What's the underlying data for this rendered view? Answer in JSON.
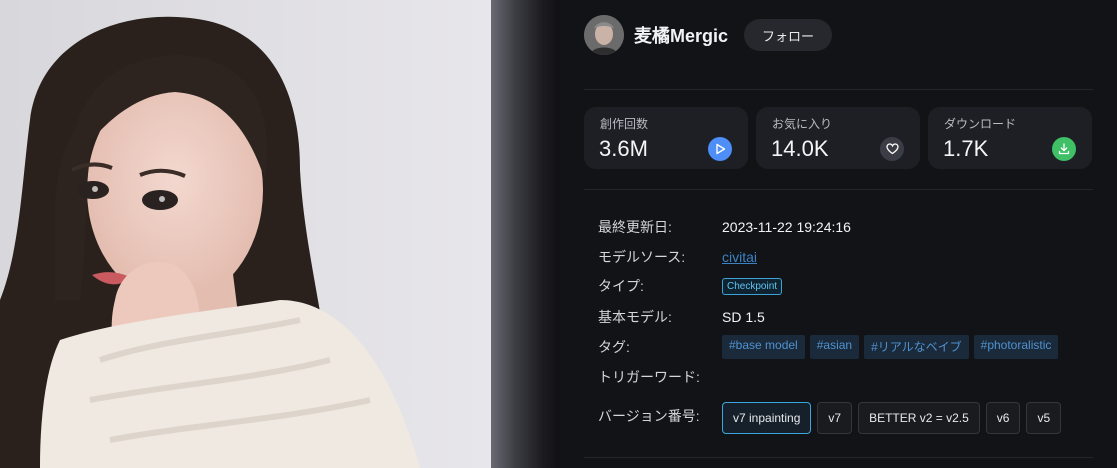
{
  "author": {
    "name": "麦橘Mergic",
    "follow_label": "フォロー"
  },
  "stats": [
    {
      "label": "創作回数",
      "value": "3.6M",
      "icon": "play-icon",
      "color": "#4d8ef7"
    },
    {
      "label": "お気に入り",
      "value": "14.0K",
      "icon": "heart-icon",
      "color": "#3a3d45"
    },
    {
      "label": "ダウンロード",
      "value": "1.7K",
      "icon": "download-icon",
      "color": "#3fbf66"
    }
  ],
  "meta": {
    "updated_label": "最終更新日:",
    "updated_value": "2023-11-22 19:24:16",
    "source_label": "モデルソース:",
    "source_value": "civitai",
    "type_label": "タイプ:",
    "type_value": "Checkpoint",
    "base_label": "基本モデル:",
    "base_value": "SD 1.5",
    "tags_label": "タグ:",
    "tags": [
      "#base model",
      "#asian",
      "#リアルなベイブ",
      "#photoralistic"
    ],
    "trigger_label": "トリガーワード:",
    "version_label": "バージョン番号:",
    "versions": [
      "v7 inpainting",
      "v7",
      "BETTER v2 = v2.5",
      "v6",
      "v5"
    ]
  },
  "colors": {
    "accent": "#3aa6db",
    "link": "#3b82c4",
    "panel": "#121316"
  }
}
